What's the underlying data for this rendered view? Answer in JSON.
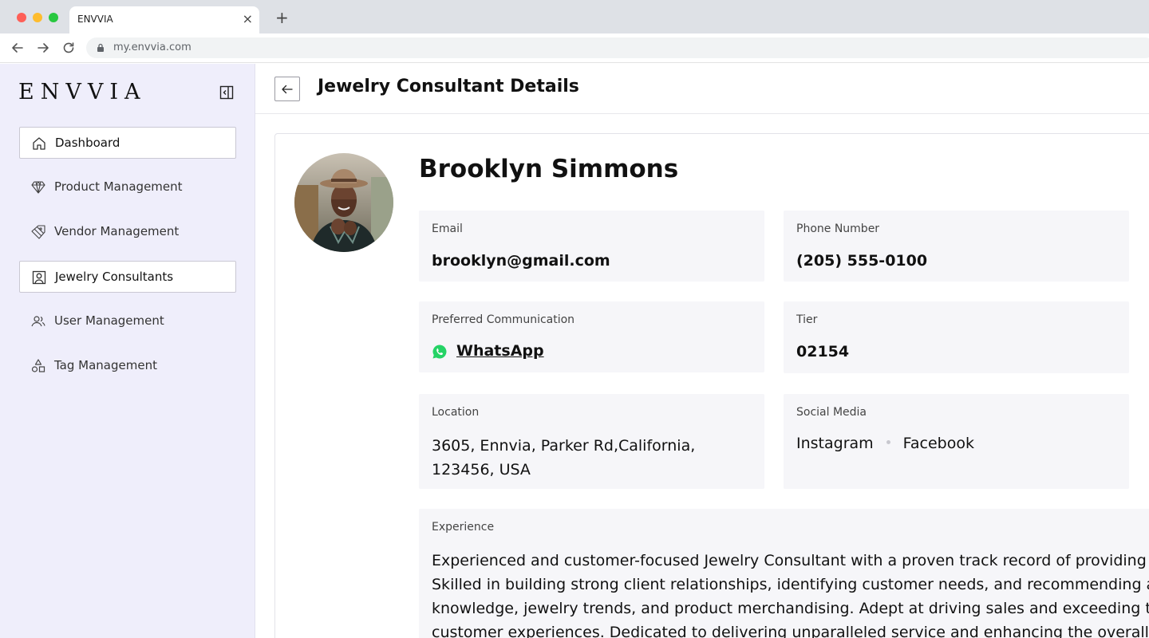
{
  "browser": {
    "tab_title": "ENVVIA",
    "tab_close": "×",
    "new_tab": "+",
    "url": "my.envvia.com"
  },
  "sidebar": {
    "logo": "ENVVIA",
    "items": [
      {
        "label": "Dashboard",
        "icon": "home-icon",
        "active": true
      },
      {
        "label": "Product Management",
        "icon": "diamond-icon",
        "active": false
      },
      {
        "label": "Vendor Management",
        "icon": "tag-stack-icon",
        "active": false
      },
      {
        "label": "Jewelry Consultants",
        "icon": "id-card-icon",
        "active": true
      },
      {
        "label": "User Management",
        "icon": "users-icon",
        "active": false
      },
      {
        "label": "Tag Management",
        "icon": "shapes-icon",
        "active": false
      }
    ]
  },
  "header": {
    "title": "Jewelry Consultant Details"
  },
  "consultant": {
    "name": "Brooklyn Simmons",
    "email_label": "Email",
    "email": "brooklyn@gmail.com",
    "phone_label": "Phone Number",
    "phone": "(205) 555-0100",
    "comm_label": "Preferred Communication",
    "comm": "WhatsApp",
    "tier_label": "Tier",
    "tier": "02154",
    "location_label": "Location",
    "location": "3605, Ennvia, Parker Rd,California, 123456, USA",
    "social_label": "Social Media",
    "social": [
      "Instagram",
      "Facebook"
    ],
    "experience_label": "Experience",
    "experience_lines": [
      "Experienced and customer-focused Jewelry Consultant with a proven track record of providing exceptional",
      "Skilled in building strong client relationships, identifying customer needs, and recommending appropriate",
      "knowledge, jewelry trends, and product merchandising. Adept at driving sales and exceeding targets throu",
      "customer experiences. Dedicated to delivering unparalleled service and enhancing the overall shopping ex"
    ]
  },
  "colors": {
    "sidebar_bg": "#efeefb",
    "field_bg": "#f6f6f9",
    "whatsapp": "#25d366"
  }
}
